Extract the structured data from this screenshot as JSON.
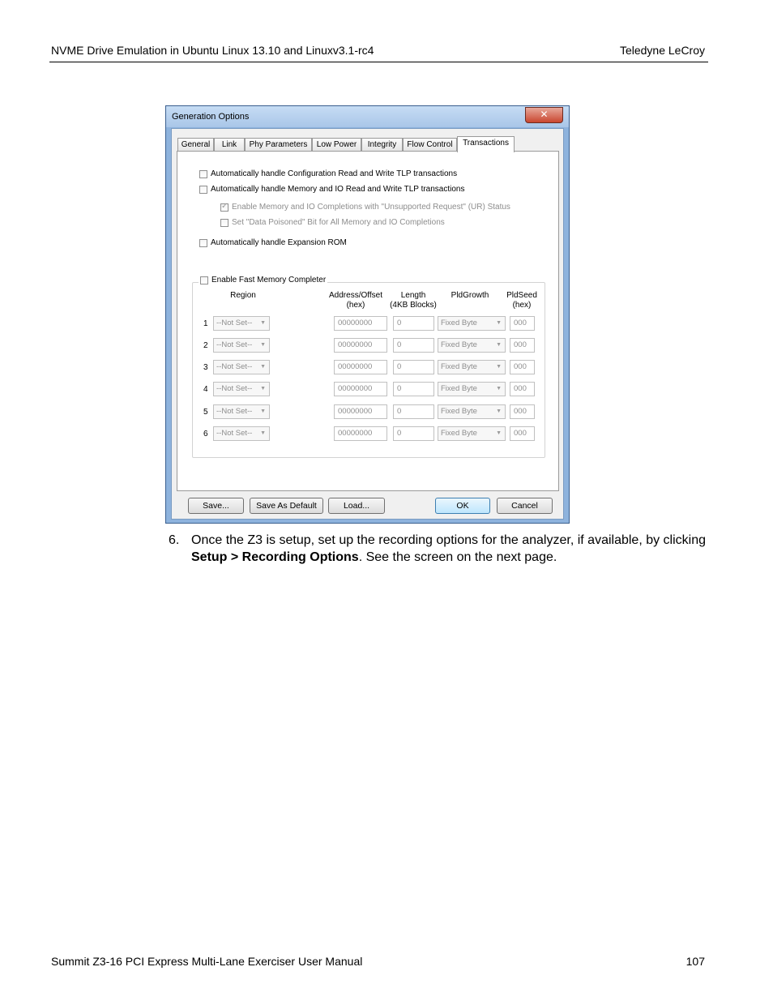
{
  "header": {
    "left": "NVME Drive Emulation in Ubuntu Linux 13.10 and Linuxv3.1-rc4",
    "right": "Teledyne  LeCroy"
  },
  "dialog": {
    "title": "Generation Options",
    "close_glyph": "✕",
    "tabs": [
      "General",
      "Link",
      "Phy Parameters",
      "Low Power",
      "Integrity",
      "Flow Control",
      "Transactions"
    ],
    "active_tab": "Transactions",
    "options": {
      "config_tlp": "Automatically handle Configuration Read and Write TLP transactions",
      "mem_io_tlp": "Automatically handle Memory and IO Read and Write TLP transactions",
      "ur_status": "Enable Memory and IO Completions with \"Unsupported Request\" (UR) Status",
      "data_poisoned": "Set \"Data Poisoned\" Bit for All Memory and IO Completions",
      "expansion_rom": "Automatically handle Expansion ROM"
    },
    "fast_memory": {
      "label": "Enable Fast Memory Completer",
      "headers": {
        "region": "Region",
        "address_1": "Address/Offset",
        "address_2": "(hex)",
        "length_1": "Length",
        "length_2": "(4KB Blocks)",
        "pldgrowth": "PldGrowth",
        "pldseed_1": "PldSeed",
        "pldseed_2": "(hex)"
      },
      "rows": [
        {
          "num": "1",
          "region": "--Not Set--",
          "address": "00000000",
          "length": "0",
          "pldgrowth": "Fixed Byte",
          "pldseed": "000"
        },
        {
          "num": "2",
          "region": "--Not Set--",
          "address": "00000000",
          "length": "0",
          "pldgrowth": "Fixed Byte",
          "pldseed": "000"
        },
        {
          "num": "3",
          "region": "--Not Set--",
          "address": "00000000",
          "length": "0",
          "pldgrowth": "Fixed Byte",
          "pldseed": "000"
        },
        {
          "num": "4",
          "region": "--Not Set--",
          "address": "00000000",
          "length": "0",
          "pldgrowth": "Fixed Byte",
          "pldseed": "000"
        },
        {
          "num": "5",
          "region": "--Not Set--",
          "address": "00000000",
          "length": "0",
          "pldgrowth": "Fixed Byte",
          "pldseed": "000"
        },
        {
          "num": "6",
          "region": "--Not Set--",
          "address": "00000000",
          "length": "0",
          "pldgrowth": "Fixed Byte",
          "pldseed": "000"
        }
      ]
    },
    "buttons": {
      "save": "Save...",
      "save_default": "Save As Default",
      "load": "Load...",
      "ok": "OK",
      "cancel": "Cancel"
    }
  },
  "step": {
    "number": "6.",
    "text_before": "Once the Z3 is setup, set up the recording options for the analyzer, if available, by clicking ",
    "bold": "Setup > Recording Options",
    "text_after": ". See the screen on the next page."
  },
  "footer": {
    "left": "Summit Z3-16 PCI Express Multi-Lane Exerciser User Manual",
    "page": "107"
  }
}
